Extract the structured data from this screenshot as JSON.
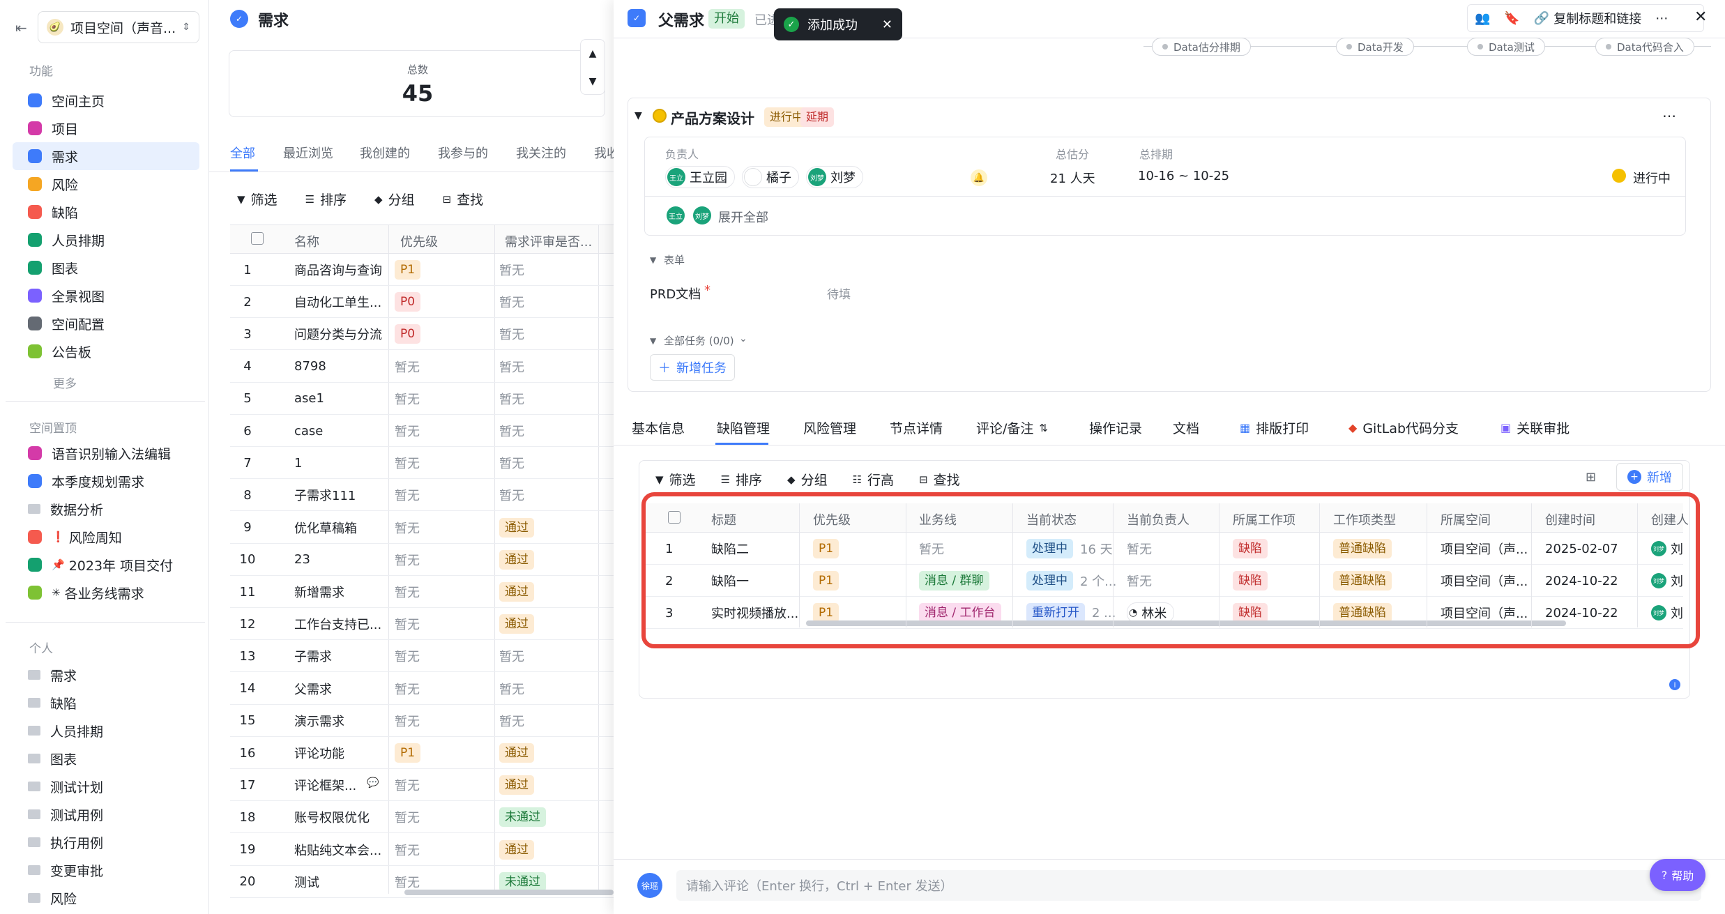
{
  "sidebar": {
    "space_name": "项目空间（声音...",
    "section_features": "功能",
    "nav": [
      {
        "label": "空间主页",
        "color": "#3e7bfa",
        "active": false,
        "icon": "home-icon"
      },
      {
        "label": "项目",
        "color": "#d43aa8",
        "active": false,
        "icon": "project-icon"
      },
      {
        "label": "需求",
        "color": "#3e7bfa",
        "active": true,
        "icon": "requirement-icon"
      },
      {
        "label": "风险",
        "color": "#f5a623",
        "active": false,
        "icon": "risk-icon"
      },
      {
        "label": "缺陷",
        "color": "#f55a4e",
        "active": false,
        "icon": "bug-icon"
      },
      {
        "label": "人员排期",
        "color": "#14a06f",
        "active": false,
        "icon": "schedule-icon"
      },
      {
        "label": "图表",
        "color": "#14a06f",
        "active": false,
        "icon": "chart-icon"
      },
      {
        "label": "全景视图",
        "color": "#7b61ff",
        "active": false,
        "icon": "panorama-icon"
      },
      {
        "label": "空间配置",
        "color": "#646a73",
        "active": false,
        "icon": "settings-icon"
      },
      {
        "label": "公告板",
        "color": "#7ec234",
        "active": false,
        "icon": "board-icon"
      }
    ],
    "more": "更多",
    "section_pinned": "空间置顶",
    "pinned": [
      {
        "label": "语音识别输入法编辑",
        "color": "#d43aa8",
        "prefix": ""
      },
      {
        "label": "本季度规划需求",
        "color": "#3e7bfa",
        "prefix": ""
      },
      {
        "label": "数据分析",
        "color": "",
        "prefix": ""
      },
      {
        "label": "风险周知",
        "color": "#f55a4e",
        "prefix": "❗"
      },
      {
        "label": "2023年 项目交付",
        "color": "#14a06f",
        "prefix": "📌"
      },
      {
        "label": "各业务线需求",
        "color": "#7ec234",
        "prefix": "✳"
      }
    ],
    "section_personal": "个人",
    "personal": [
      "需求",
      "缺陷",
      "人员排期",
      "图表",
      "测试计划",
      "测试用例",
      "执行用例",
      "变更审批",
      "风险"
    ]
  },
  "list": {
    "header_title": "需求",
    "total_label": "总数",
    "total_value": "45",
    "tabs": [
      "全部",
      "最近浏览",
      "我创建的",
      "我参与的",
      "我关注的",
      "我收"
    ],
    "toolbar": [
      "筛选",
      "排序",
      "分组",
      "查找"
    ],
    "columns": [
      "名称",
      "优先级",
      "需求评审是否..."
    ],
    "rows": [
      {
        "n": "1",
        "name": "商品咨询与查询",
        "pri": "P1",
        "review": "暂无"
      },
      {
        "n": "2",
        "name": "自动化工单生...",
        "pri": "P0",
        "review": "暂无"
      },
      {
        "n": "3",
        "name": "问题分类与分流",
        "pri": "P0",
        "review": "暂无"
      },
      {
        "n": "4",
        "name": "8798",
        "pri": "暂无",
        "review": "暂无"
      },
      {
        "n": "5",
        "name": "ase1",
        "pri": "暂无",
        "review": "暂无"
      },
      {
        "n": "6",
        "name": "case",
        "pri": "暂无",
        "review": "暂无"
      },
      {
        "n": "7",
        "name": "1",
        "pri": "暂无",
        "review": "暂无"
      },
      {
        "n": "8",
        "name": "子需求111",
        "pri": "暂无",
        "review": "暂无"
      },
      {
        "n": "9",
        "name": "优化草稿箱",
        "pri": "暂无",
        "review": "通过"
      },
      {
        "n": "10",
        "name": "23",
        "pri": "暂无",
        "review": "通过"
      },
      {
        "n": "11",
        "name": "新增需求",
        "pri": "暂无",
        "review": "通过"
      },
      {
        "n": "12",
        "name": "工作台支持已...",
        "pri": "暂无",
        "review": "通过"
      },
      {
        "n": "13",
        "name": "子需求",
        "pri": "暂无",
        "review": "暂无"
      },
      {
        "n": "14",
        "name": "父需求",
        "pri": "暂无",
        "review": "暂无"
      },
      {
        "n": "15",
        "name": "演示需求",
        "pri": "暂无",
        "review": "暂无"
      },
      {
        "n": "16",
        "name": "评论功能",
        "pri": "P1",
        "review": "通过"
      },
      {
        "n": "17",
        "name": "评论框架...",
        "pri": "暂无",
        "review": "通过"
      },
      {
        "n": "18",
        "name": "账号权限优化",
        "pri": "暂无",
        "review": "未通过"
      },
      {
        "n": "19",
        "name": "粘贴纯文本会...",
        "pri": "暂无",
        "review": "通过"
      },
      {
        "n": "20",
        "name": "测试",
        "pri": "暂无",
        "review": "未通过"
      }
    ]
  },
  "detail": {
    "title": "父需求",
    "status_tag": "开始",
    "status_extra": "已进",
    "toast": "添加成功",
    "copy_link": "复制标题和链接",
    "stages": [
      "Data估分排期",
      "Data开发",
      "Data测试",
      "Data代码合入"
    ],
    "node_title": "产品方案设计",
    "node_tags": [
      "进行中",
      "延期"
    ],
    "owner_label": "负责人",
    "estimate_label": "总估分",
    "schedule_label": "总排期",
    "owners": [
      "王立园",
      "橘子",
      "刘梦"
    ],
    "estimate_value": "21 人天",
    "schedule_value": "10-16 ~ 10-25",
    "node_status": "进行中",
    "expand_all": "展开全部",
    "form_label": "表单",
    "prd_label": "PRD文档",
    "prd_required": "*",
    "prd_value": "待填",
    "all_tasks": "全部任务 (0/0)",
    "add_task": "新增任务",
    "tabs": [
      "基本信息",
      "缺陷管理",
      "风险管理",
      "节点详情",
      "评论/备注",
      "操作记录",
      "文档",
      "排版打印",
      "GitLab代码分支",
      "关联审批"
    ],
    "active_tab": "缺陷管理",
    "defect_toolbar": [
      "筛选",
      "排序",
      "分组",
      "行高",
      "查找"
    ],
    "add_button": "新增",
    "defect_columns": [
      "标题",
      "优先级",
      "业务线",
      "当前状态",
      "当前负责人",
      "所属工作项",
      "工作项类型",
      "所属空间",
      "创建时间",
      "创建人"
    ],
    "defects": [
      {
        "n": "1",
        "title": "缺陷二",
        "pri": "P1",
        "line": "暂无",
        "state": "处理中",
        "state_extra": "16 天",
        "owner": "暂无",
        "item": "缺陷",
        "type": "普通缺陷",
        "space": "项目空间（声...",
        "created": "2025-02-07",
        "creator": "刘"
      },
      {
        "n": "2",
        "title": "缺陷一",
        "pri": "P1",
        "line": "消息 / 群聊",
        "state": "处理中",
        "state_extra": "2 个...",
        "owner": "暂无",
        "item": "缺陷",
        "type": "普通缺陷",
        "space": "项目空间（声...",
        "created": "2024-10-22",
        "creator": "刘"
      },
      {
        "n": "3",
        "title": "实时视频播放...",
        "pri": "P1",
        "line": "消息 / 工作台",
        "state": "重新打开",
        "state_extra": "2 ...",
        "owner": "林米",
        "item": "缺陷",
        "type": "普通缺陷",
        "space": "项目空间（声...",
        "created": "2024-10-22",
        "creator": "刘"
      }
    ],
    "comment_avatar": "徐瑶",
    "comment_placeholder": "请输入评论（Enter 换行，Ctrl + Enter 发送）",
    "help": "帮助"
  },
  "colors": {
    "accent": "#3e7bfa",
    "highlight_border": "#e8453c"
  }
}
